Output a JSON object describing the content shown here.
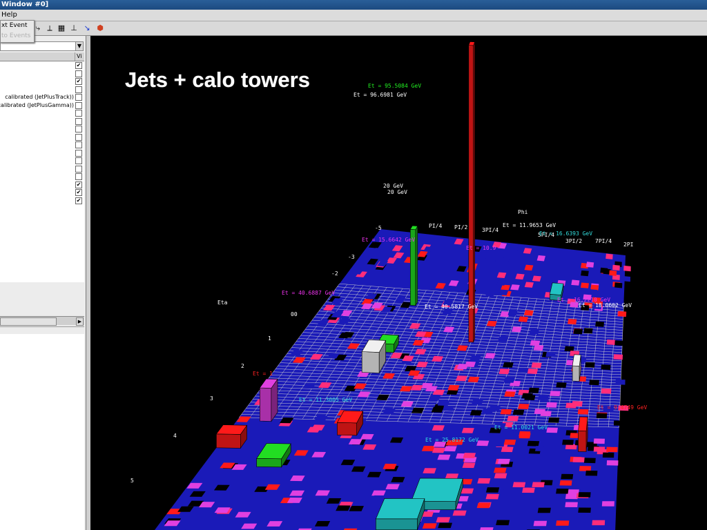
{
  "window": {
    "title": "Window #0]"
  },
  "menu": {
    "items": [
      "Help"
    ]
  },
  "dropdown": {
    "items": [
      {
        "label": "xt Event",
        "enabled": true
      },
      {
        "label": "to Events",
        "enabled": false
      }
    ]
  },
  "sidebar": {
    "column_header": "Vi",
    "rows": [
      {
        "label": "",
        "checked": true
      },
      {
        "label": "",
        "checked": false
      },
      {
        "label": "",
        "checked": true
      },
      {
        "label": "",
        "checked": false
      },
      {
        "label": "calibrated (JetPlusTrack))",
        "checked": false
      },
      {
        "label": "calibrated (JetPlusGamma))",
        "checked": false
      },
      {
        "label": "",
        "checked": false
      },
      {
        "label": "",
        "checked": false
      },
      {
        "label": "",
        "checked": false
      },
      {
        "label": "",
        "checked": false
      },
      {
        "label": "",
        "checked": false
      },
      {
        "label": "",
        "checked": false
      },
      {
        "label": "",
        "checked": false
      },
      {
        "label": "",
        "checked": false
      },
      {
        "label": "",
        "checked": false
      },
      {
        "label": "",
        "checked": true
      },
      {
        "label": "",
        "checked": true
      },
      {
        "label": "",
        "checked": true
      }
    ]
  },
  "view": {
    "title": "Jets + calo towers",
    "eta_label": "Eta",
    "phi_label": "Phi",
    "eta_ticks": [
      "-5",
      "-3",
      "-2",
      "00",
      "1",
      "2",
      "3",
      "4",
      "5"
    ],
    "phi_ticks": [
      "PI/4",
      "PI/2",
      "3PI/4",
      "5PI/4",
      "3PI/2",
      "7PI/4",
      "2PI"
    ],
    "scale_label": "20 GeV",
    "scale_label_2": "20 GeV",
    "et_labels": [
      {
        "text": "Et = 95.5084 GeV",
        "color": "#22ee22"
      },
      {
        "text": "Et = 96.6981 GeV",
        "color": "#ffffff"
      },
      {
        "text": "Et = 11.9653 GeV",
        "color": "#ffffff"
      },
      {
        "text": "Et = 16.6393 GeV",
        "color": "#33dddd"
      },
      {
        "text": "Et = 15.6642 GeV",
        "color": "#ee33ee"
      },
      {
        "text": "Et = 10.9",
        "color": "#ee33ee"
      },
      {
        "text": "Et = 40.6887 GeV",
        "color": "#ee33ee"
      },
      {
        "text": "Et = 40.5817 GeV",
        "color": "#ffffff"
      },
      {
        "text": "Et = 16.2210 GeV",
        "color": "#ee33ee"
      },
      {
        "text": "Et = 18.0602 GeV",
        "color": "#ffffff"
      },
      {
        "text": "Et = 11.3005 GeV",
        "color": "#33dddd"
      },
      {
        "text": "Et = 11.0021 GeV",
        "color": "#33dddd"
      },
      {
        "text": "Et = 25.8172 GeV",
        "color": "#33dddd"
      },
      {
        "text": "Et = 9.4749 GeV",
        "color": "#ff2222"
      },
      {
        "text": "Et = 1",
        "color": "#ff2222"
      }
    ],
    "colors": {
      "floor": "#1a1ab8",
      "grid": "#d0d0d0",
      "tower_red": "#ff1a1a",
      "tower_pink": "#ff2d7a",
      "tower_magenta": "#e040e0",
      "tower_green": "#22dd22",
      "tower_cyan": "#22c4c4",
      "tower_white": "#f0f0f0"
    }
  }
}
